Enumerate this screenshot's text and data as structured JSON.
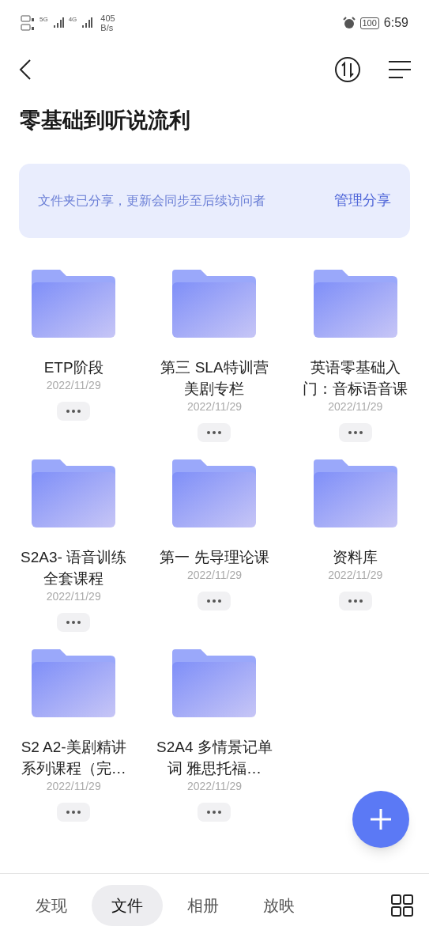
{
  "status_bar": {
    "net_5g": "5G",
    "net_4g": "4G",
    "speed": "405",
    "speed_unit": "B/s",
    "battery": "100",
    "time": "6:59"
  },
  "title": "零基础到听说流利",
  "share_banner": {
    "message": "文件夹已分享，更新会同步至后续访问者",
    "action": "管理分享"
  },
  "folders": [
    {
      "name": "ETP阶段",
      "date": "2022/11/29"
    },
    {
      "name": "第三 SLA特训营美剧专栏",
      "date": "2022/11/29"
    },
    {
      "name": "英语零基础入门：音标语音课",
      "date": "2022/11/29"
    },
    {
      "name": "S2A3- 语音训练全套课程",
      "date": "2022/11/29"
    },
    {
      "name": "第一 先导理论课",
      "date": "2022/11/29"
    },
    {
      "name": "资料库",
      "date": "2022/11/29"
    },
    {
      "name": "S2 A2-美剧精讲系列课程（完…",
      "date": "2022/11/29"
    },
    {
      "name": "S2A4 多情景记单词 雅思托福…",
      "date": "2022/11/29"
    }
  ],
  "bottom_nav": [
    {
      "label": "发现",
      "selected": false
    },
    {
      "label": "文件",
      "selected": true
    },
    {
      "label": "相册",
      "selected": false
    },
    {
      "label": "放映",
      "selected": false
    }
  ]
}
